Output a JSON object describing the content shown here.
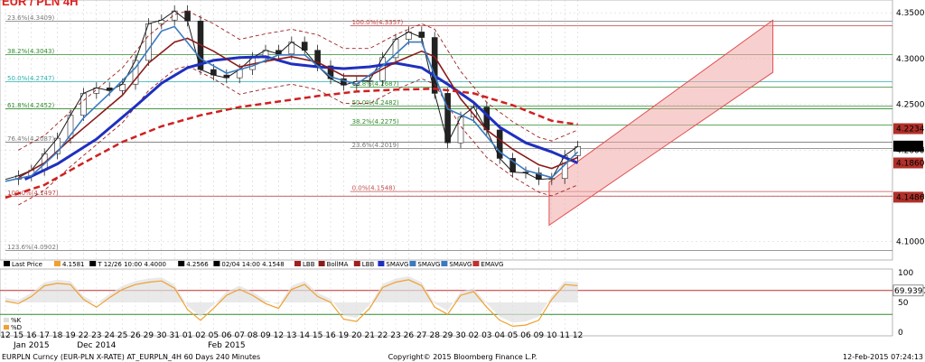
{
  "chart_data": [
    {
      "type": "line",
      "title": "EUR / PLN 4H",
      "ylim": [
        4.08,
        4.36
      ],
      "y_ticks": [
        4.1,
        4.15,
        4.2,
        4.25,
        4.3,
        4.35
      ],
      "x_ticks": [
        "12",
        "15",
        "16",
        "17",
        "18",
        "19",
        "22",
        "23",
        "24",
        "25",
        "26",
        "29",
        "30",
        "31",
        "01",
        "02",
        "05",
        "06",
        "07",
        "08",
        "09",
        "12",
        "13",
        "14",
        "15",
        "16",
        "19",
        "20",
        "21",
        "22",
        "23",
        "26",
        "27",
        "28",
        "29",
        "30",
        "02",
        "03",
        "04",
        "05",
        "06",
        "09",
        "10",
        "11",
        "12"
      ],
      "months": [
        {
          "label": "Dec 2014",
          "at": "23"
        },
        {
          "label": "Jan 2015",
          "at": "16"
        },
        {
          "label": "Feb 2015",
          "at": "06"
        }
      ],
      "grid": true,
      "legend_position": "bottom",
      "legend": [
        {
          "name": "Last Price",
          "color": "#000000"
        },
        {
          "name": "4.1581",
          "color": "#f0a030"
        },
        {
          "name": "T 12/26 10:00 4.4000",
          "color": "#000000"
        },
        {
          "name": "4.2566",
          "color": "#000000"
        },
        {
          "name": "02/04 14:00 4.1548",
          "color": "#000000"
        },
        {
          "name": "LBB",
          "color": "#a02020"
        },
        {
          "name": "BollMA",
          "color": "#8b1a1a"
        },
        {
          "name": "LBB",
          "color": "#a02020"
        },
        {
          "name": "SMAVG",
          "color": "#1f2fbf"
        },
        {
          "name": "SMAVG",
          "color": "#3a7ac0"
        },
        {
          "name": "SMAVG",
          "color": "#3a7ac0"
        },
        {
          "name": "EMAVG",
          "color": "#c03030"
        }
      ],
      "price_labels": [
        {
          "value": 4.2234,
          "text": "4.2234",
          "color": "#b0302a"
        },
        {
          "value": 4.2044,
          "text": "4.2044",
          "color": "#000000"
        },
        {
          "value": 4.186,
          "text": "4.1860",
          "color": "#b0302a"
        },
        {
          "value": 4.1486,
          "text": "4.1486",
          "color": "#b0302a"
        }
      ],
      "fib_levels": [
        {
          "label": "23.6%(4.3409)",
          "value": 4.3409,
          "start": 0,
          "color": "#777777"
        },
        {
          "label": "38.2%(4.3043)",
          "value": 4.3043,
          "start": 0,
          "color": "#2e8b2e"
        },
        {
          "label": "50.0%(4.2747)",
          "value": 4.2747,
          "start": 0,
          "color": "#2ab0b0"
        },
        {
          "label": "61.8%(4.2452)",
          "value": 4.2452,
          "start": 0,
          "color": "#2e8b2e"
        },
        {
          "label": "76.4%(4.2087)",
          "value": 4.2087,
          "start": 0,
          "color": "#777777"
        },
        {
          "label": "100.0%(4.1497)",
          "value": 4.1497,
          "start": 0,
          "color": "#c05050"
        },
        {
          "label": "123.6%(4.0902)",
          "value": 4.0902,
          "start": 0,
          "color": "#777777"
        },
        {
          "label": "100.0%(4.3357)",
          "value": 4.3357,
          "start": 26.5,
          "color": "#c04040"
        },
        {
          "label": "61.8%(4.2687)",
          "value": 4.2687,
          "start": 26.5,
          "color": "#2e8b2e"
        },
        {
          "label": "50.0%(4.2482)",
          "value": 4.2482,
          "start": 26.5,
          "color": "#2e8b2e"
        },
        {
          "label": "38.2%(4.2275)",
          "value": 4.2275,
          "start": 26.5,
          "color": "#2e8b2e"
        },
        {
          "label": "23.6%(4.2019)",
          "value": 4.2019,
          "start": 26.5,
          "color": "#777777"
        },
        {
          "label": "0.0%(4.1548)",
          "value": 4.1548,
          "start": 26.5,
          "color": "#c05050"
        }
      ],
      "series": [
        {
          "name": "Last Price",
          "color": "#1a1a1a",
          "values": [
            [
              0,
              4.168
            ],
            [
              1,
              4.172
            ],
            [
              2,
              4.178
            ],
            [
              3,
              4.196
            ],
            [
              4,
              4.213
            ],
            [
              5,
              4.238
            ],
            [
              6,
              4.262
            ],
            [
              7,
              4.268
            ],
            [
              8,
              4.265
            ],
            [
              9,
              4.272
            ],
            [
              10,
              4.298
            ],
            [
              11,
              4.338
            ],
            [
              12,
              4.342
            ],
            [
              13,
              4.352
            ],
            [
              14,
              4.341
            ],
            [
              15,
              4.288
            ],
            [
              16,
              4.282
            ],
            [
              17,
              4.279
            ],
            [
              18,
              4.288
            ],
            [
              19,
              4.301
            ],
            [
              20,
              4.309
            ],
            [
              21,
              4.305
            ],
            [
              22,
              4.318
            ],
            [
              23,
              4.309
            ],
            [
              24,
              4.292
            ],
            [
              25,
              4.278
            ],
            [
              26,
              4.271
            ],
            [
              27,
              4.275
            ],
            [
              28,
              4.276
            ],
            [
              29,
              4.301
            ],
            [
              30,
              4.321
            ],
            [
              31,
              4.329
            ],
            [
              32,
              4.323
            ],
            [
              33,
              4.262
            ],
            [
              34,
              4.208
            ],
            [
              35,
              4.236
            ],
            [
              36,
              4.247
            ],
            [
              37,
              4.222
            ],
            [
              38,
              4.191
            ],
            [
              39,
              4.176
            ],
            [
              40,
              4.175
            ],
            [
              41,
              4.168
            ],
            [
              42,
              4.169
            ],
            [
              43,
              4.194
            ],
            [
              44,
              4.204
            ]
          ]
        },
        {
          "name": "SMAVG 200",
          "color": "#1f2fbf",
          "values": [
            [
              1.5,
              4.168
            ],
            [
              4,
              4.185
            ],
            [
              7,
              4.212
            ],
            [
              10,
              4.248
            ],
            [
              12,
              4.273
            ],
            [
              14,
              4.29
            ],
            [
              16,
              4.298
            ],
            [
              18,
              4.301
            ],
            [
              20,
              4.302
            ],
            [
              22,
              4.294
            ],
            [
              24,
              4.291
            ],
            [
              26,
              4.289
            ],
            [
              28,
              4.291
            ],
            [
              30,
              4.295
            ],
            [
              32,
              4.29
            ],
            [
              34,
              4.272
            ],
            [
              36,
              4.252
            ],
            [
              38,
              4.225
            ],
            [
              40,
              4.208
            ],
            [
              42,
              4.198
            ],
            [
              44,
              4.186
            ]
          ]
        },
        {
          "name": "BollMA",
          "color": "#8b1a1a",
          "values": [
            [
              1,
              4.17
            ],
            [
              3,
              4.186
            ],
            [
              5,
              4.212
            ],
            [
              7,
              4.236
            ],
            [
              9,
              4.26
            ],
            [
              11,
              4.295
            ],
            [
              13,
              4.318
            ],
            [
              14,
              4.322
            ],
            [
              16,
              4.308
            ],
            [
              18,
              4.291
            ],
            [
              20,
              4.297
            ],
            [
              22,
              4.302
            ],
            [
              24,
              4.296
            ],
            [
              26,
              4.281
            ],
            [
              28,
              4.281
            ],
            [
              30,
              4.296
            ],
            [
              32,
              4.308
            ],
            [
              33,
              4.302
            ],
            [
              35,
              4.256
            ],
            [
              37,
              4.222
            ],
            [
              39,
              4.201
            ],
            [
              41,
              4.184
            ],
            [
              42,
              4.18
            ],
            [
              44,
              4.192
            ]
          ]
        },
        {
          "name": "EMAVG",
          "color": "#d02020",
          "dashed": true,
          "values": [
            [
              0,
              4.148
            ],
            [
              3,
              4.162
            ],
            [
              6,
              4.186
            ],
            [
              9,
              4.209
            ],
            [
              12,
              4.226
            ],
            [
              15,
              4.238
            ],
            [
              18,
              4.247
            ],
            [
              21,
              4.253
            ],
            [
              24,
              4.259
            ],
            [
              27,
              4.264
            ],
            [
              30,
              4.266
            ],
            [
              33,
              4.267
            ],
            [
              36,
              4.262
            ],
            [
              39,
              4.249
            ],
            [
              42,
              4.232
            ],
            [
              44,
              4.228
            ]
          ]
        },
        {
          "name": "SMAVG fast",
          "color": "#3a7ac0",
          "values": [
            [
              0,
              4.166
            ],
            [
              2,
              4.172
            ],
            [
              4,
              4.198
            ],
            [
              6,
              4.235
            ],
            [
              8,
              4.262
            ],
            [
              10,
              4.29
            ],
            [
              12,
              4.33
            ],
            [
              13,
              4.335
            ],
            [
              15,
              4.3
            ],
            [
              17,
              4.284
            ],
            [
              19,
              4.292
            ],
            [
              21,
              4.304
            ],
            [
              23,
              4.304
            ],
            [
              25,
              4.28
            ],
            [
              27,
              4.272
            ],
            [
              29,
              4.292
            ],
            [
              31,
              4.318
            ],
            [
              32,
              4.318
            ],
            [
              34,
              4.245
            ],
            [
              36,
              4.232
            ],
            [
              38,
              4.198
            ],
            [
              40,
              4.178
            ],
            [
              42,
              4.17
            ],
            [
              44,
              4.198
            ]
          ]
        }
      ],
      "channel": {
        "lower_start": [
          41.8,
          4.118
        ],
        "lower_end": [
          59,
          4.285
        ],
        "upper_start": [
          41.8,
          4.165
        ],
        "upper_end": [
          59,
          4.342
        ],
        "fill": "#f2a8a8",
        "border": "#e05050"
      }
    },
    {
      "type": "area",
      "ylim": [
        0,
        100
      ],
      "y_ticks": [
        0,
        50,
        100
      ],
      "current_label": "69.9397",
      "levels": [
        {
          "value": 70,
          "color": "#c03030"
        },
        {
          "value": 30,
          "color": "#2e8b2e"
        }
      ],
      "legend": [
        {
          "name": "%K",
          "color": "#dddddd"
        },
        {
          "name": "%D",
          "color": "#f0a030"
        }
      ],
      "series": [
        {
          "name": "%D",
          "color": "#f0a030",
          "values": [
            [
              0,
              52
            ],
            [
              1,
              48
            ],
            [
              2,
              60
            ],
            [
              3,
              78
            ],
            [
              4,
              82
            ],
            [
              5,
              80
            ],
            [
              6,
              55
            ],
            [
              7,
              42
            ],
            [
              8,
              58
            ],
            [
              9,
              72
            ],
            [
              10,
              80
            ],
            [
              11,
              84
            ],
            [
              12,
              86
            ],
            [
              13,
              74
            ],
            [
              14,
              38
            ],
            [
              15,
              20
            ],
            [
              16,
              40
            ],
            [
              17,
              62
            ],
            [
              18,
              72
            ],
            [
              19,
              62
            ],
            [
              20,
              48
            ],
            [
              21,
              40
            ],
            [
              22,
              72
            ],
            [
              23,
              80
            ],
            [
              24,
              60
            ],
            [
              25,
              50
            ],
            [
              26,
              22
            ],
            [
              27,
              18
            ],
            [
              28,
              40
            ],
            [
              29,
              75
            ],
            [
              30,
              84
            ],
            [
              31,
              88
            ],
            [
              32,
              78
            ],
            [
              33,
              42
            ],
            [
              34,
              30
            ],
            [
              35,
              62
            ],
            [
              36,
              68
            ],
            [
              37,
              42
            ],
            [
              38,
              20
            ],
            [
              39,
              10
            ],
            [
              40,
              12
            ],
            [
              41,
              20
            ],
            [
              42,
              55
            ],
            [
              43,
              80
            ],
            [
              44,
              78
            ]
          ]
        }
      ]
    }
  ],
  "footer": {
    "left": "EURPLN Curncy (EUR-PLN X-RATE) AT_EURPLN_4H 60 Days 240 Minutes",
    "center": "Copyright© 2015 Bloomberg Finance L.P.",
    "right": "12-Feb-2015 07:24:13"
  }
}
